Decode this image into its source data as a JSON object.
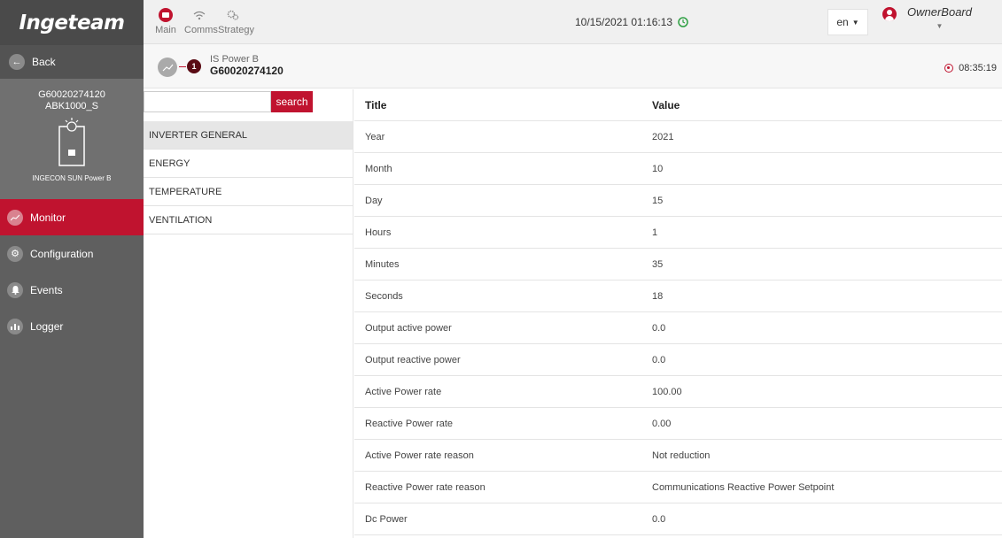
{
  "app": {
    "logo_text": "Ingeteam"
  },
  "topbar": {
    "nav": [
      {
        "label": "Main",
        "icon": "monitor-icon"
      },
      {
        "label": "Comms",
        "icon": "wifi-icon"
      },
      {
        "label": "Strategy",
        "icon": "gears-icon"
      }
    ],
    "datetime": "10/15/2021 01:16:13",
    "language": "en",
    "user": "OwnerBoard"
  },
  "sidebar": {
    "back_label": "Back",
    "device_id": "G60020274120",
    "device_model": "ABK1000_S",
    "device_name": "INGECON SUN Power B",
    "items": [
      {
        "label": "Monitor",
        "icon": "chart-icon",
        "active": true
      },
      {
        "label": "Configuration",
        "icon": "gear-icon",
        "active": false
      },
      {
        "label": "Events",
        "icon": "bell-icon",
        "active": false
      },
      {
        "label": "Logger",
        "icon": "bar-chart-icon",
        "active": false
      }
    ]
  },
  "device_header": {
    "badge": "1",
    "subtitle": "IS Power B",
    "title": "G60020274120",
    "time": "08:35:19"
  },
  "categories": {
    "search_value": "",
    "search_button": "search",
    "items": [
      "INVERTER GENERAL",
      "ENERGY",
      "TEMPERATURE",
      "VENTILATION"
    ],
    "selected": "INVERTER GENERAL"
  },
  "table": {
    "headers": [
      "Title",
      "Value"
    ],
    "rows": [
      [
        "Year",
        "2021"
      ],
      [
        "Month",
        "10"
      ],
      [
        "Day",
        "15"
      ],
      [
        "Hours",
        "1"
      ],
      [
        "Minutes",
        "35"
      ],
      [
        "Seconds",
        "18"
      ],
      [
        "Output active power",
        "0.0"
      ],
      [
        "Output reactive power",
        "0.0"
      ],
      [
        "Active Power rate",
        "100.00"
      ],
      [
        "Reactive Power rate",
        "0.00"
      ],
      [
        "Active Power rate reason",
        "Not reduction"
      ],
      [
        "Reactive Power rate reason",
        "Communications Reactive Power Setpoint"
      ],
      [
        "Dc Power",
        "0.0"
      ]
    ]
  },
  "colors": {
    "accent": "#c0132f",
    "sidebar_bg": "#5f5f5f",
    "ok_green": "#2ea043"
  }
}
